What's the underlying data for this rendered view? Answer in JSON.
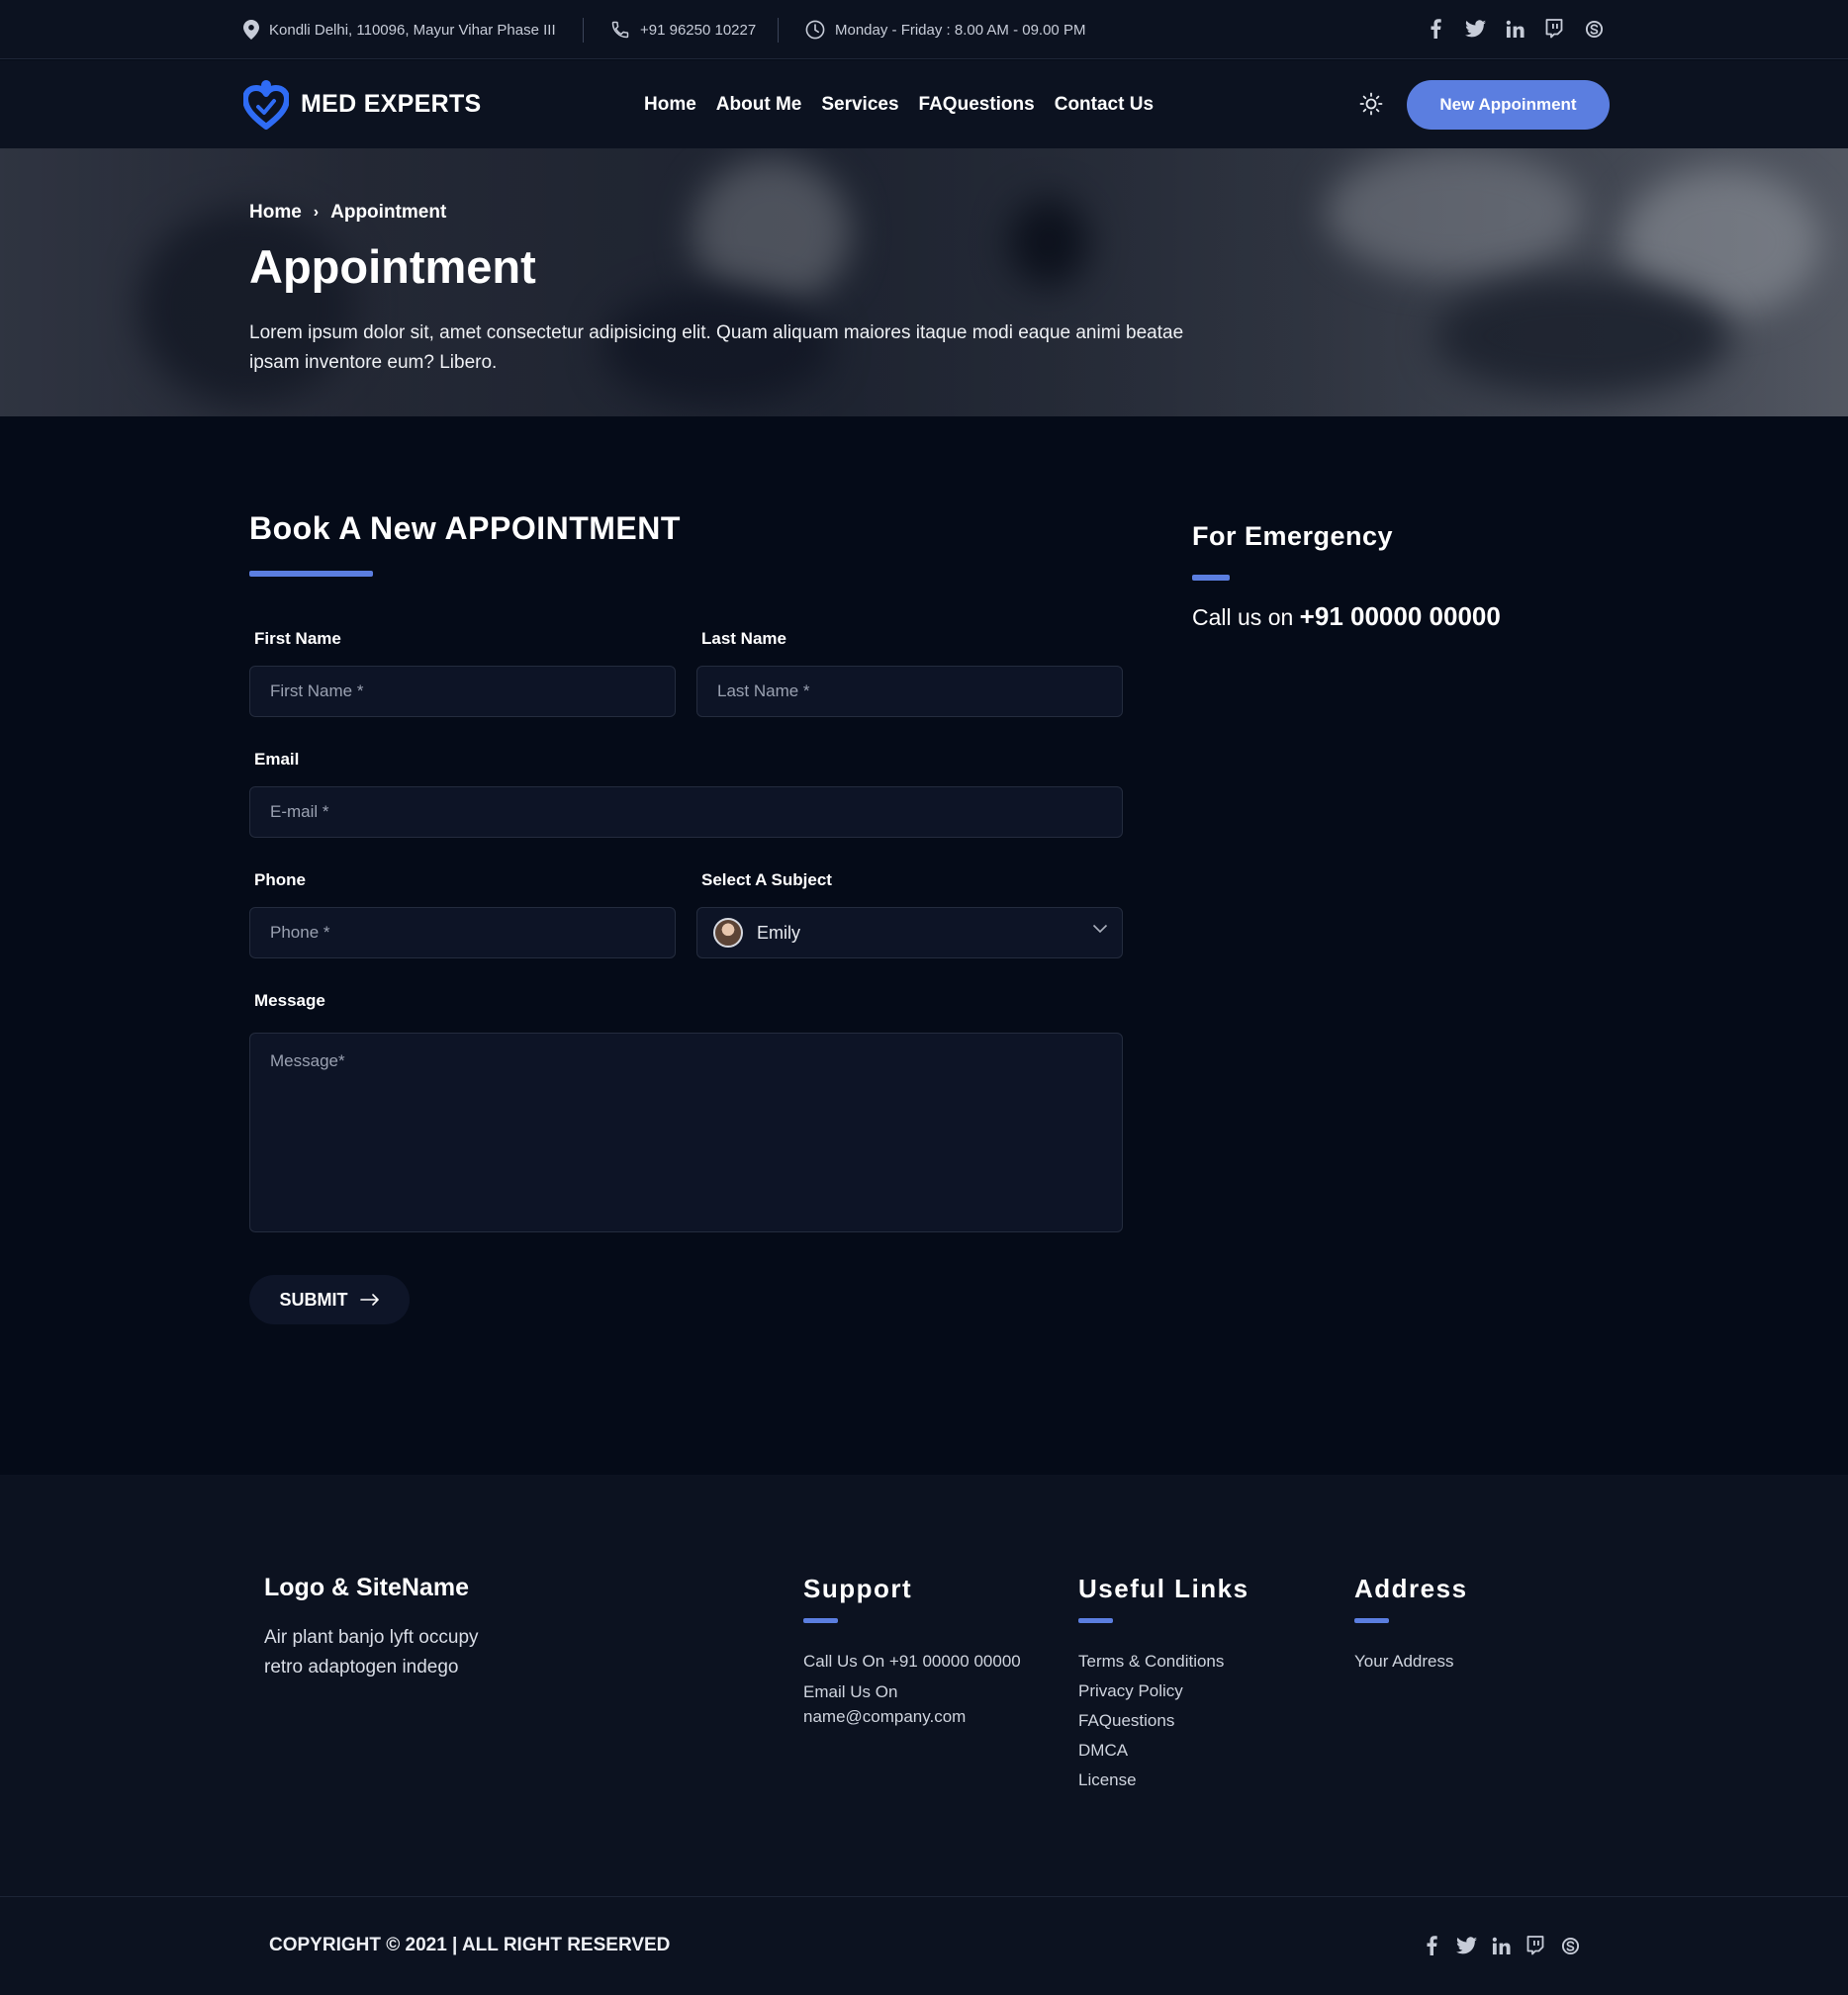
{
  "topbar": {
    "address": "Kondli Delhi, 110096, Mayur Vihar Phase III",
    "phone": "+91 96250 10227",
    "hours": "Monday - Friday : 8.00 AM - 09.00 PM"
  },
  "social_icons": [
    "facebook-icon",
    "twitter-icon",
    "linkedin-icon",
    "twitch-icon",
    "skype-icon"
  ],
  "navbar": {
    "brand": "MED EXPERTS",
    "menu": [
      "Home",
      "About Me",
      "Services",
      "FAQuestions",
      "Contact Us"
    ],
    "cta": "New Appoinment"
  },
  "hero": {
    "breadcrumb_home": "Home",
    "breadcrumb_current": "Appointment",
    "title": "Appointment",
    "text": "Lorem ipsum dolor sit, amet consectetur adipisicing elit. Quam aliquam maiores itaque modi eaque animi beatae ipsam inventore eum? Libero."
  },
  "form": {
    "title": "Book A New APPOINTMENT",
    "first_name_label": "First Name",
    "first_name_placeholder": "First Name *",
    "last_name_label": "Last Name",
    "last_name_placeholder": "Last Name *",
    "email_label": "Email",
    "email_placeholder": "E-mail *",
    "phone_label": "Phone",
    "phone_placeholder": "Phone *",
    "subject_label": "Select A Subject",
    "subject_value": "Emily",
    "message_label": "Message",
    "message_placeholder": "Message*",
    "submit": "SUBMIT"
  },
  "emergency": {
    "title": "For Emergency",
    "call_prefix": "Call us on",
    "number": "+91 00000 00000"
  },
  "footer": {
    "about_title": "Logo & SiteName",
    "about_text": "Air plant banjo lyft occupy retro adaptogen indego",
    "support_title": "Support",
    "support_call": "Call Us On +91 00000 00000",
    "support_email_label": "Email Us On",
    "support_email": "name@company.com",
    "links_title": "Useful Links",
    "links": [
      "Terms & Conditions",
      "Privacy Policy",
      "FAQuestions",
      "DMCA",
      "License"
    ],
    "address_title": "Address",
    "address": "Your Address",
    "copyright": "COPYRIGHT © 2021 | ALL RIGHT RESERVED"
  },
  "colors": {
    "accent": "#5b7ee0",
    "background": "#050b18",
    "panel": "#0c1220",
    "brand_icon": "#2f6cf5"
  }
}
